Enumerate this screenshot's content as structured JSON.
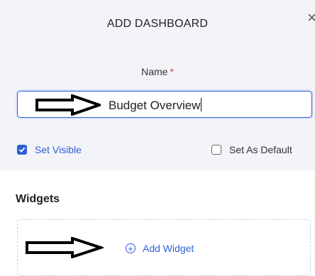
{
  "dialog": {
    "title": "ADD DASHBOARD",
    "close_glyph": "×"
  },
  "form": {
    "name_label": "Name",
    "required_mark": "*",
    "name_value": "Budget Overview",
    "set_visible": {
      "label": "Set Visible",
      "checked": true
    },
    "set_default": {
      "label": "Set As Default",
      "checked": false
    }
  },
  "widgets": {
    "title": "Widgets",
    "add_label": "Add Widget",
    "add_icon": "plus-circle-icon"
  },
  "annotations": {
    "arrow_icon": "arrow-right-icon"
  },
  "colors": {
    "accent": "#2f5fd6",
    "panel_bg": "#f3f4f8",
    "required": "#e03a3a"
  }
}
